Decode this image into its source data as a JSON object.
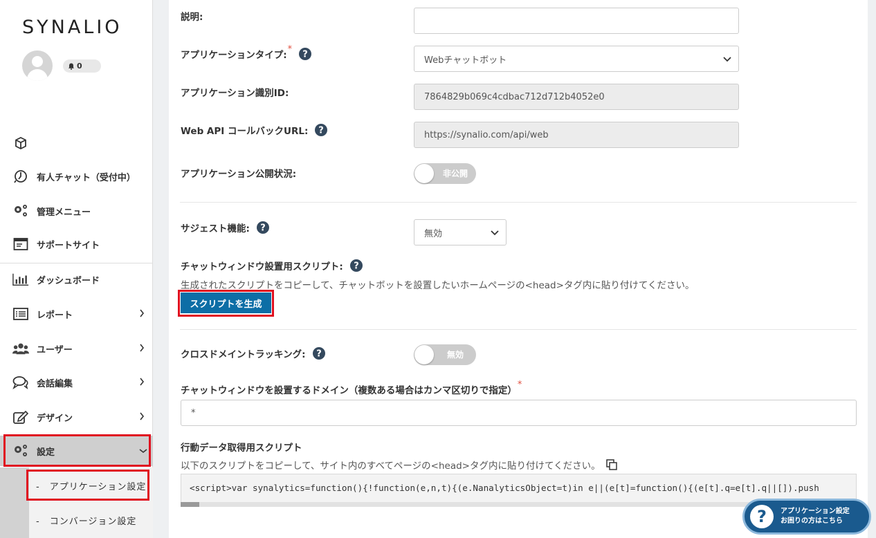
{
  "brand": {
    "logo_text": "SYNALIO",
    "accent_color": "#0d6ea6",
    "highlight_color": "#e01020"
  },
  "user": {
    "notification_count": "0"
  },
  "sidebar": {
    "items": [
      {
        "icon": "cube-icon",
        "label": ""
      },
      {
        "icon": "headset-icon",
        "label": "有人チャット（受付中）"
      },
      {
        "icon": "gears-icon",
        "label": "管理メニュー"
      },
      {
        "icon": "browser-window-icon",
        "label": "サポートサイト"
      },
      {
        "icon": "bar-chart-icon",
        "label": "ダッシュボード"
      },
      {
        "icon": "list-icon",
        "label": "レポート"
      },
      {
        "icon": "users-icon",
        "label": "ユーザー"
      },
      {
        "icon": "chat-bubbles-icon",
        "label": "会話編集"
      },
      {
        "icon": "pencil-square-icon",
        "label": "デザイン"
      },
      {
        "icon": "gears-icon",
        "label": "設定"
      }
    ],
    "sub_items": [
      {
        "label": "-　アプリケーション設定"
      },
      {
        "label": "-　コンバージョン設定"
      }
    ]
  },
  "form": {
    "description": {
      "label": "説明:",
      "value": ""
    },
    "app_type": {
      "label": "アプリケーションタイプ:",
      "required_mark": "*",
      "selected": "Webチャットボット"
    },
    "app_id": {
      "label": "アプリケーション識別ID:",
      "value": "7864829b069c4cdbac712d712b4052e0"
    },
    "callback_url": {
      "label": "Web API コールバックURL:",
      "value": "https://synalio.com/api/web"
    },
    "publish_status": {
      "label": "アプリケーション公開状況:",
      "toggle_text": "非公開"
    },
    "suggest": {
      "label": "サジェスト機能:",
      "selected": "無効"
    },
    "chat_script": {
      "label": "チャットウィンドウ設置用スクリプト:",
      "description": "生成されたスクリプトをコピーして、チャットボットを設置したいホームページの<head>タグ内に貼り付けてください。",
      "button": "スクリプトを生成"
    },
    "cross_domain": {
      "label": "クロスドメイントラッキング:",
      "toggle_text": "無効"
    },
    "domains": {
      "label": "チャットウィンドウを設置するドメイン（複数ある場合はカンマ区切りで指定）",
      "required_mark": "*",
      "value": "*"
    },
    "behavior_script": {
      "label": "行動データ取得用スクリプト",
      "description": "以下のスクリプトをコピーして、サイト内のすべてページの<head>タグ内に貼り付けてください。",
      "code": "<script>var synalytics=function(){!function(e,n,t){(e.NanalyticsObject=t)in e||(e[t]=function(){(e[t].q=e[t].q||[]).push"
    }
  },
  "floating_help": {
    "line1": "アプリケーション設定",
    "line2": "お困りの方はこちら"
  }
}
